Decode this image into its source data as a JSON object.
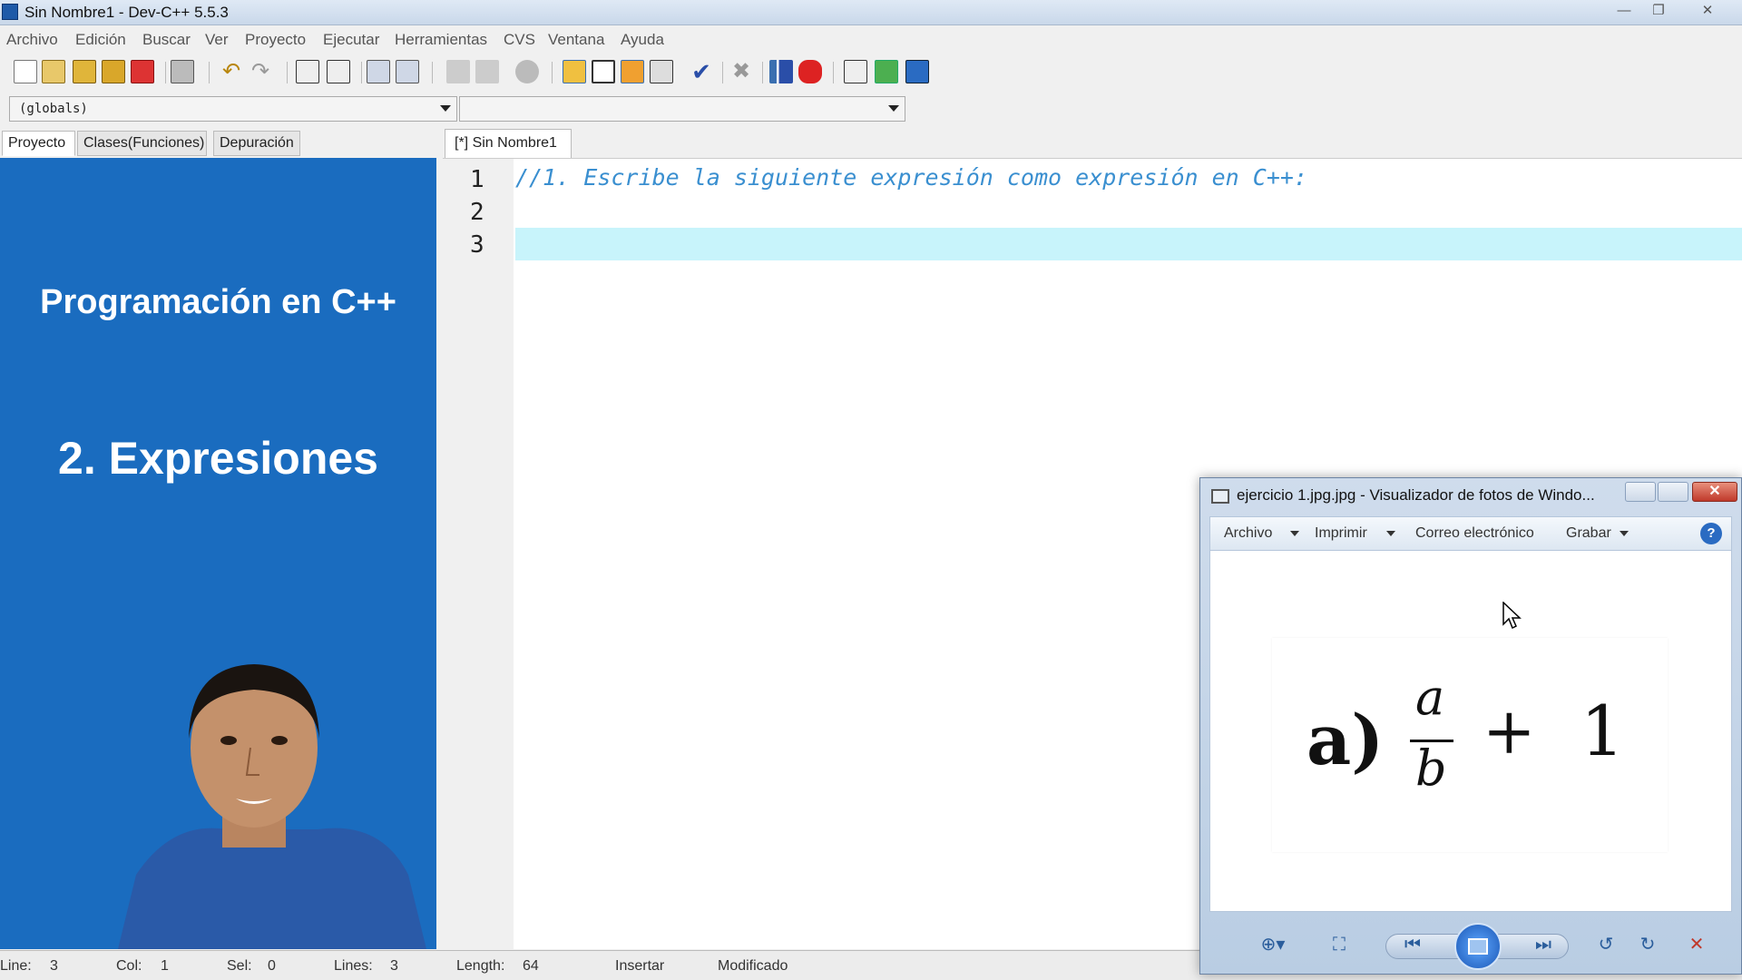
{
  "window": {
    "title": "Sin Nombre1 - Dev-C++ 5.5.3",
    "controls": {
      "minimize": "—",
      "maximize": "❐",
      "close": "✕"
    }
  },
  "menubar": [
    "Archivo",
    "Edición",
    "Buscar",
    "Ver",
    "Proyecto",
    "Ejecutar",
    "Herramientas",
    "CVS",
    "Ventana",
    "Ayuda"
  ],
  "toolbar": {
    "buttons": [
      "new-file-icon",
      "open-file-icon",
      "save-icon",
      "save-all-icon",
      "close-file-icon",
      "print-icon",
      "undo-icon",
      "redo-icon",
      "find-icon",
      "replace-icon",
      "indent-icon",
      "unindent-icon",
      "goto-back-icon",
      "goto-forward-icon",
      "bookmark-icon",
      "compile-icon",
      "run-icon",
      "compile-run-icon",
      "rebuild-icon",
      "syntax-check-icon",
      "stop-icon",
      "chart-icon",
      "debug-icon",
      "project-add-icon",
      "project-remove-icon",
      "project-options-icon"
    ]
  },
  "combos": {
    "left_value": "(globals)",
    "right_value": ""
  },
  "left_tabs": [
    "Proyecto",
    "Clases(Funciones)",
    "Depuración"
  ],
  "left_panel": {
    "line1": "Programación en C++",
    "line2": "2. Expresiones"
  },
  "editor": {
    "tab_label": "[*] Sin Nombre1",
    "line_numbers": [
      "1",
      "2",
      "3"
    ],
    "lines": [
      "//1. Escribe la siguiente expresión como expresión en C++:",
      "",
      ""
    ]
  },
  "status": {
    "line_label": "Line:",
    "line_value": "3",
    "col_label": "Col:",
    "col_value": "1",
    "sel_label": "Sel:",
    "sel_value": "0",
    "lines_label": "Lines:",
    "lines_value": "3",
    "length_label": "Length:",
    "length_value": "64",
    "mode": "Insertar",
    "state": "Modificado"
  },
  "viewer": {
    "title": "ejercicio 1.jpg.jpg - Visualizador de fotos de Windo...",
    "menu": [
      "Archivo",
      "Imprimir",
      "Correo electrónico",
      "Grabar"
    ],
    "help": "?",
    "image": {
      "label": "a)",
      "numerator": "a",
      "denominator": "b",
      "operator": "+",
      "constant": "1"
    }
  }
}
